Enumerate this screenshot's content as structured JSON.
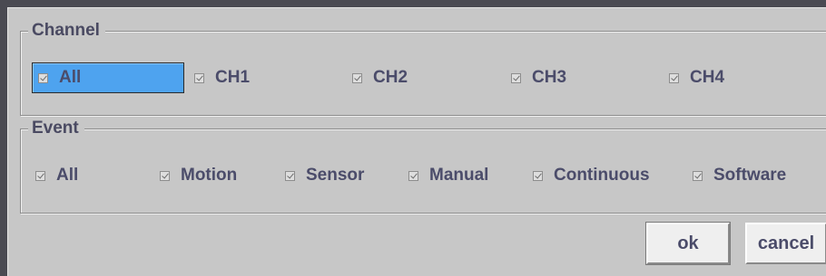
{
  "channel": {
    "legend": "Channel",
    "items": [
      {
        "label": "All",
        "checked": true,
        "selected": true
      },
      {
        "label": "CH1",
        "checked": true
      },
      {
        "label": "CH2",
        "checked": true
      },
      {
        "label": "CH3",
        "checked": true
      },
      {
        "label": "CH4",
        "checked": true
      }
    ]
  },
  "event": {
    "legend": "Event",
    "items": [
      {
        "label": "All",
        "checked": true
      },
      {
        "label": "Motion",
        "checked": true
      },
      {
        "label": "Sensor",
        "checked": true
      },
      {
        "label": "Manual",
        "checked": true
      },
      {
        "label": "Continuous",
        "checked": true
      },
      {
        "label": "Software",
        "checked": true
      }
    ]
  },
  "buttons": {
    "ok_label": "ok",
    "cancel_label": "cancel"
  },
  "colors": {
    "background": "#c7c7c7",
    "text": "#4b4c6a",
    "selection": "#4ea3ef"
  }
}
